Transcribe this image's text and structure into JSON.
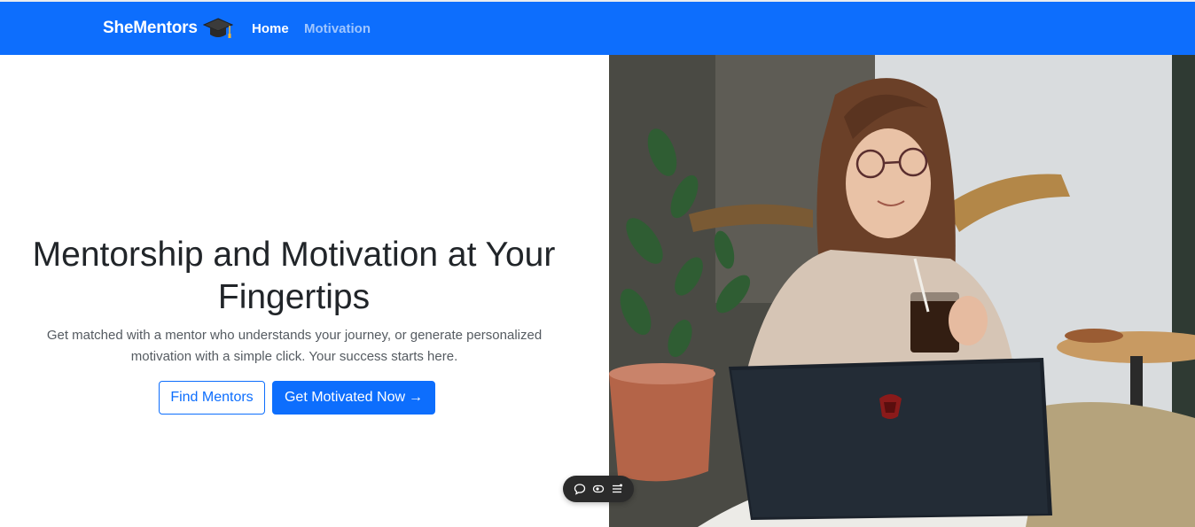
{
  "navbar": {
    "brand": "SheMentors",
    "brand_icon": "graduation-cap-icon",
    "background_color": "#0d6efd",
    "links": [
      {
        "label": "Home",
        "active": true
      },
      {
        "label": "Motivation",
        "active": false
      }
    ]
  },
  "hero": {
    "title": "Mentorship and Motivation at Your Fingertips",
    "subtitle": "Get matched with a mentor who understands your journey, or generate personalized motivation with a simple click. Your success starts here.",
    "buttons": {
      "find_mentors": "Find Mentors",
      "get_motivated": "Get Motivated Now",
      "get_motivated_icon": "arrow-right-icon",
      "arrow": "→"
    },
    "accent_color": "#0d6efd"
  },
  "floating_toolbar": {
    "icons": [
      "comment-icon",
      "eye-icon",
      "list-settings-icon"
    ]
  }
}
